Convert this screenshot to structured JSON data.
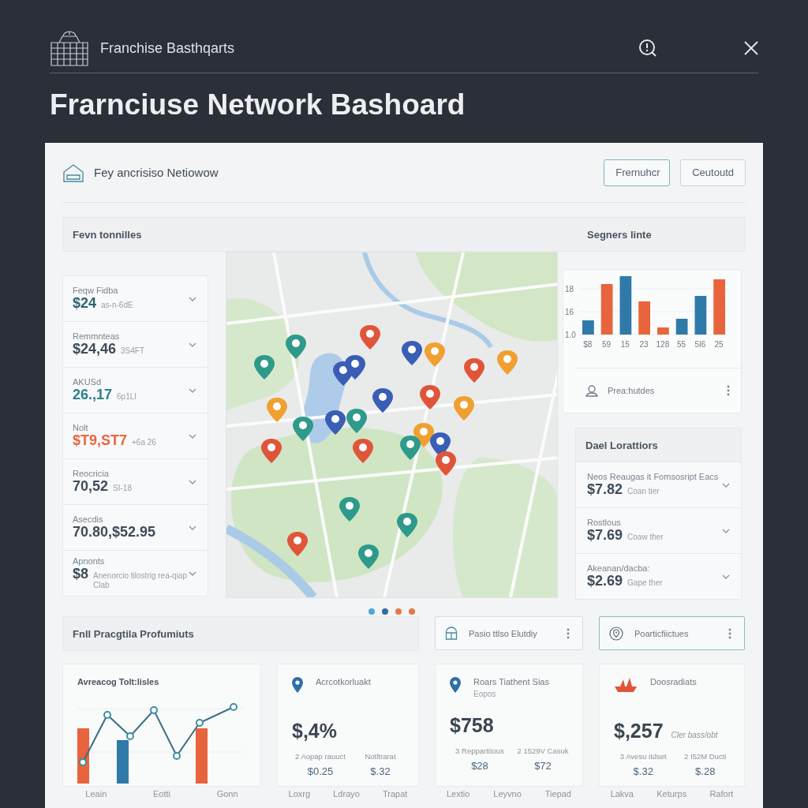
{
  "app_bar": {
    "title": "Franchise Basthqarts"
  },
  "page_title": "Frarnciuse Network Bashoard",
  "panel": {
    "title": "Fey ancrisiso Netiowow",
    "buttons": [
      {
        "label": "Frernuhcr",
        "selected": true
      },
      {
        "label": "Ceutoutd",
        "selected": false
      }
    ]
  },
  "overview": {
    "left_heading": "Fevn tonnilles",
    "right_heading": "Segners linte"
  },
  "metrics": [
    {
      "label": "Feqw Fidba",
      "value": "$24",
      "note": "as-n-6dE",
      "color": "#2e6272"
    },
    {
      "label": "Remmnteas",
      "value": "$24,46",
      "note": "3S4FT",
      "color": "#3e4c5a"
    },
    {
      "label": "AKUSd",
      "value": "26.,17",
      "note": "6p1LI",
      "color": "#2d7f8e"
    },
    {
      "label": "Nolt",
      "value": "$T9,ST7",
      "note": "+6a 26",
      "color": "#e8663d"
    },
    {
      "label": "Reocricia",
      "value": "70,52",
      "note": "SI-18",
      "color": "#3e4c5a"
    },
    {
      "label": "Asecdis",
      "value": "70.80,$52.95",
      "color": "#3e4c5a"
    },
    {
      "label": "Apnonts",
      "value": "$8",
      "note": "Anenorcio tilostrig rea-qiap Clab",
      "color": "#3e4c5a"
    }
  ],
  "bar_chart": {
    "y_labels": [
      "18",
      "16",
      "1.0"
    ],
    "x_labels": [
      "$8",
      "59",
      "15",
      "23",
      "128",
      "55",
      "5I6",
      "25"
    ]
  },
  "profile_row": {
    "label": "Prea:hutdes"
  },
  "locations": {
    "title": "Dael Lorattiors",
    "items": [
      {
        "label": "Neos Reaugas it Fomsosript Eacs",
        "value": "$7.82",
        "note": "Coan tier"
      },
      {
        "label": "Rostlous",
        "value": "$7.69",
        "note": "Coaw ther"
      },
      {
        "label": "Akeanan/dacba:",
        "value": "$2.69",
        "note": "Gape ther"
      }
    ]
  },
  "pager_dots": [
    {
      "color": "#4aa8d8"
    },
    {
      "color": "#2f6f9f"
    },
    {
      "color": "#e07a4a"
    },
    {
      "color": "#e07a4a"
    }
  ],
  "performance": {
    "heading": "Fnll Pracgtila Profumiuts",
    "actions": [
      {
        "kind": "cabinet",
        "label": "Pasio ttlso Elutdiy",
        "selected": false
      },
      {
        "kind": "pin",
        "label": "Poarticfiictues",
        "selected": true
      }
    ]
  },
  "trend_card": {
    "title": "Avreacog Tolt:lisles",
    "footer": [
      "Leain",
      "Eotti",
      "Gonn"
    ]
  },
  "stat_cards": [
    {
      "kind": "pin",
      "title": "Acrcotkorluakt",
      "value": "$,4%",
      "stats": [
        {
          "label": "2 Aopap rauuct",
          "value": "$0.25"
        },
        {
          "label": "Notltrarat",
          "value": "$.32"
        }
      ],
      "footer": [
        "Loxrg",
        "Ldrayo",
        "Trapat"
      ]
    },
    {
      "kind": "pin",
      "title": "Roars Tiathent Sias",
      "subtitle": "Eopos",
      "value": "$758",
      "stats": [
        {
          "label": "3 Reppartitous",
          "value": "$28"
        },
        {
          "label": "2 1529V Casuk",
          "value": "$72"
        }
      ],
      "footer": [
        "Lextio",
        "Leyvno",
        "Tiepad"
      ]
    },
    {
      "kind": "boat",
      "title": "Doosradiats",
      "value": "$,257",
      "value_note": "Cler bass/obt",
      "stats": [
        {
          "label": "3 Avesu itdset",
          "value": "$.32"
        },
        {
          "label": "2 I52M Ducti",
          "value": "$.28"
        }
      ],
      "footer": [
        "Lakva",
        "Keturps",
        "Rafort"
      ]
    }
  ]
}
